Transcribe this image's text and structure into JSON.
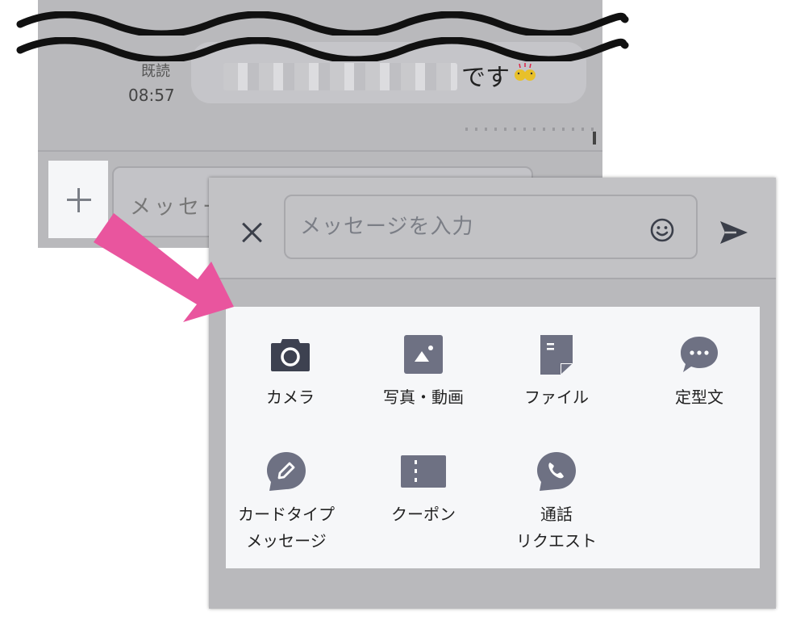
{
  "background_chat": {
    "read_label": "既読",
    "read_time": "08:57",
    "message_suffix": "です",
    "input_placeholder": "メッセー"
  },
  "panel": {
    "input_placeholder": "メッセージを入力"
  },
  "menu": {
    "items": [
      {
        "icon": "camera-icon",
        "label": "カメラ"
      },
      {
        "icon": "photo-video-icon",
        "label": "写真・動画"
      },
      {
        "icon": "file-icon",
        "label": "ファイル"
      },
      {
        "icon": "template-message-icon",
        "label": "定型文"
      },
      {
        "icon": "card-message-icon",
        "label": "カードタイプ\nメッセージ"
      },
      {
        "icon": "coupon-icon",
        "label": "クーポン"
      },
      {
        "icon": "call-request-icon",
        "label": "通話\nリクエスト"
      }
    ]
  },
  "colors": {
    "arrow": "#e9559e",
    "icon": "#6e7183",
    "sheet_background": "#f6f7f9",
    "dimmed_background": "#b9b9bc"
  }
}
